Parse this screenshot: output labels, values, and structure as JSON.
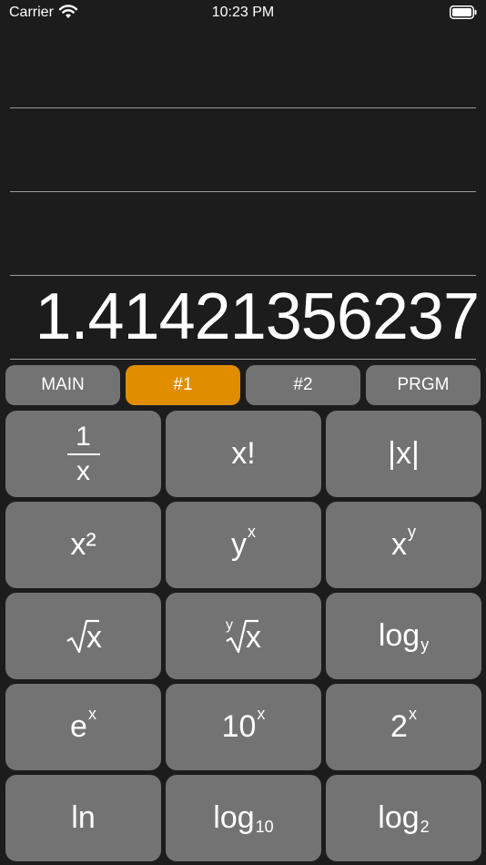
{
  "status": {
    "carrier": "Carrier",
    "time": "10:23 PM"
  },
  "display": {
    "value": "1.41421356237"
  },
  "tabs": [
    {
      "label": "MAIN"
    },
    {
      "label": "#1",
      "active": true
    },
    {
      "label": "#2"
    },
    {
      "label": "PRGM"
    }
  ],
  "keys": {
    "reciprocal": {
      "num": "1",
      "den": "x"
    },
    "factorial": "x!",
    "abs": "|x|",
    "square": "x²",
    "y_pow_x": {
      "base": "y",
      "exp": "x"
    },
    "x_pow_y": {
      "base": "x",
      "exp": "y"
    },
    "sqrt": "x",
    "yroot": {
      "index": "y",
      "radicand": "x"
    },
    "log_y": {
      "base": "log",
      "sub": "y"
    },
    "e_pow_x": {
      "base": "e",
      "exp": "x"
    },
    "ten_pow_x": {
      "base": "10",
      "exp": "x"
    },
    "two_pow_x": {
      "base": "2",
      "exp": "x"
    },
    "ln": "ln",
    "log10": {
      "base": "log",
      "sub": "10"
    },
    "log2": {
      "base": "log",
      "sub": "2"
    }
  },
  "colors": {
    "background": "#1c1c1c",
    "key": "#737373",
    "active_tab": "#e08d00"
  }
}
